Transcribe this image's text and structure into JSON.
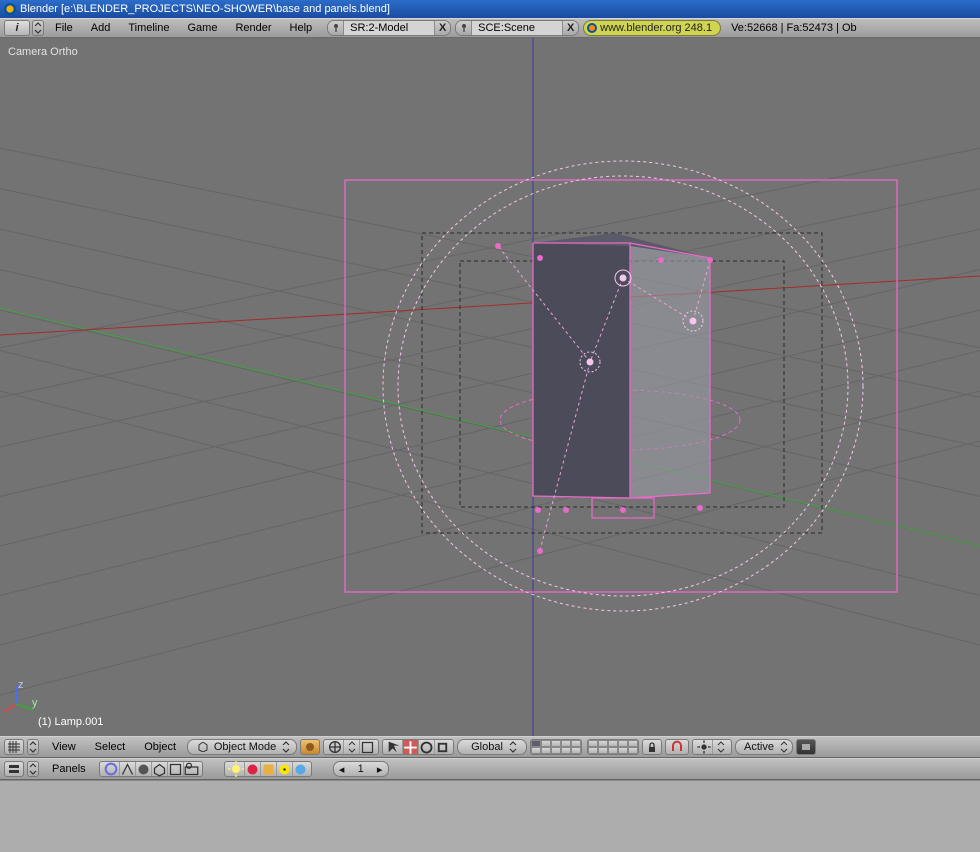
{
  "window": {
    "title": "Blender [e:\\BLENDER_PROJECTS\\NEO-SHOWER\\base and panels.blend]"
  },
  "topmenu": {
    "items": [
      "File",
      "Add",
      "Timeline",
      "Game",
      "Render",
      "Help"
    ],
    "screen_field": "SR:2-Model",
    "scene_field": "SCE:Scene",
    "url_label": "www.blender.org 248.1",
    "stats": "Ve:52668 | Fa:52473 | Ob"
  },
  "viewport": {
    "projection_label": "Camera Ortho",
    "active_object": "(1) Lamp.001"
  },
  "header3d": {
    "menus": [
      "View",
      "Select",
      "Object"
    ],
    "mode": "Object Mode",
    "orientation": "Global",
    "transform_label": "Active"
  },
  "buttons": {
    "label": "Panels",
    "frame": "1"
  }
}
